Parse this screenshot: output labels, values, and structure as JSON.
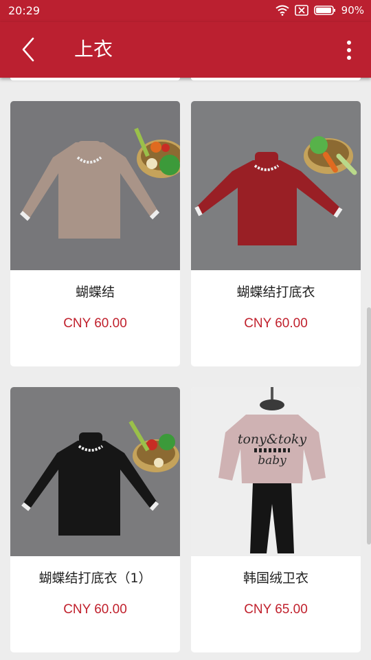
{
  "status": {
    "time": "20:29",
    "battery": "90%"
  },
  "appbar": {
    "title": "上衣",
    "back_icon": "chevron-left-icon",
    "more_icon": "more-vertical-icon"
  },
  "theme": {
    "primary": "#bb2030",
    "price_color": "#c0202c"
  },
  "products": [
    {
      "name": "蝴蝶结",
      "price": "CNY 60.00",
      "sweater_color": "#a99488"
    },
    {
      "name": "蝴蝶结打底衣",
      "price": "CNY 60.00",
      "sweater_color": "#991f25"
    },
    {
      "name": "蝴蝶结打底衣（1）",
      "price": "CNY 60.00",
      "sweater_color": "#161616"
    },
    {
      "name": "韩国绒卫衣",
      "price": "CNY 65.00",
      "sweater_color": "#cfb2b3"
    }
  ]
}
